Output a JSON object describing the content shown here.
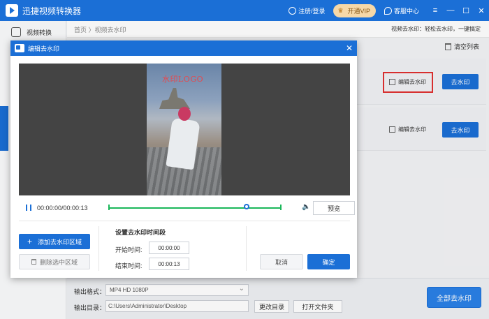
{
  "app": {
    "title": "迅捷视频转换器",
    "register_login": "注册/登录",
    "vip_label": "开通VIP",
    "customer_service": "客服中心",
    "min_symbol": "—",
    "max_symbol": "☐",
    "close_symbol": "✕"
  },
  "sidebar": {
    "items": [
      {
        "label": "视频转换"
      }
    ]
  },
  "breadcrumb": {
    "home": "首页",
    "sep": " 〉",
    "current": "视频去水印",
    "tip": "视频去水印：轻松去水印，一键搞定"
  },
  "list": {
    "clear_label": "清空列表",
    "rows": [
      {
        "edit_label": "编辑去水印",
        "action_label": "去水印"
      },
      {
        "edit_label": "编辑去水印",
        "action_label": "去水印"
      }
    ]
  },
  "bottom": {
    "format_label": "输出格式：",
    "format_value": "MP4   HD 1080P",
    "dir_label": "输出目录：",
    "dir_value": "C:\\Users\\Administrator\\Desktop",
    "change_dir": "更改目录",
    "open_folder": "打开文件夹",
    "all_button": "全部去水印"
  },
  "dialog": {
    "title": "编辑去水印",
    "close_symbol": "✕",
    "watermark_text": "水印LOGO",
    "time_display": "00:00:00/00:00:13",
    "playhead_fraction": 0.8,
    "preview_label": "预览",
    "volume_glyph": "🔈",
    "add_area_label": "添加去水印区域",
    "add_plus": "+",
    "delete_area_label": "删除选中区域",
    "segment_title": "设置去水印时间段",
    "start_label": "开始时间:",
    "start_value": "00:00:00",
    "end_label": "结束时间:",
    "end_value": "00:00:13",
    "cancel_label": "取消",
    "ok_label": "确定"
  },
  "colors": {
    "brand": "#1b6fd6",
    "timeline": "#1ab75a",
    "highlight": "#e03030"
  }
}
